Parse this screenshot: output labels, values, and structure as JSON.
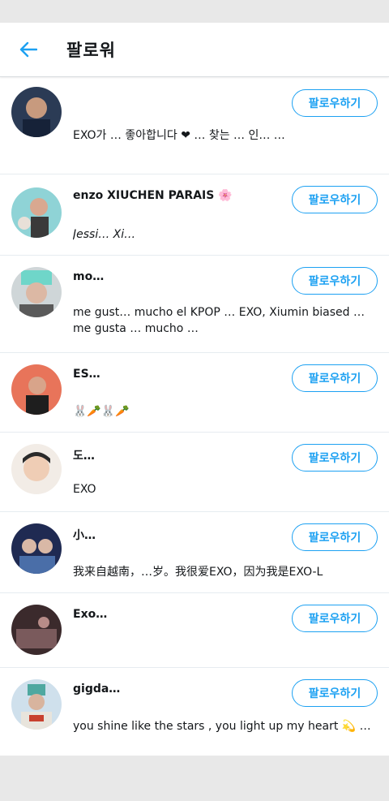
{
  "header": {
    "title": "팔로워",
    "back_icon": "back-arrow-icon"
  },
  "colors": {
    "accent": "#1da1f2"
  },
  "followers": [
    {
      "name": "",
      "bio": "EXO가 … 좋아합니다 ❤ … 찾는 … 인… …",
      "button": "팔로우하기"
    },
    {
      "name": "enzo XIUCHEN PARAIS 🌸",
      "bio": "Jessi… Xi…",
      "button": "팔로우하기"
    },
    {
      "name": "mo…",
      "bio": "me gust… mucho el KPOP … EXO, Xiumin biased … me gusta … mucho …",
      "button": "팔로우하기"
    },
    {
      "name": "ES…",
      "bio": "🐰🥕🐰🥕",
      "button": "팔로우하기"
    },
    {
      "name": "도…",
      "bio": "EXO",
      "button": "팔로우하기"
    },
    {
      "name": "小…",
      "bio": "我来自越南，…岁。我很爱EXO，因为我是EXO-L",
      "button": "팔로우하기"
    },
    {
      "name": "Exo…",
      "bio": "",
      "button": "팔로우하기"
    },
    {
      "name": "gigda…",
      "bio": "you shine like the stars , you light up my heart 💫 …",
      "button": "팔로우하기"
    }
  ]
}
